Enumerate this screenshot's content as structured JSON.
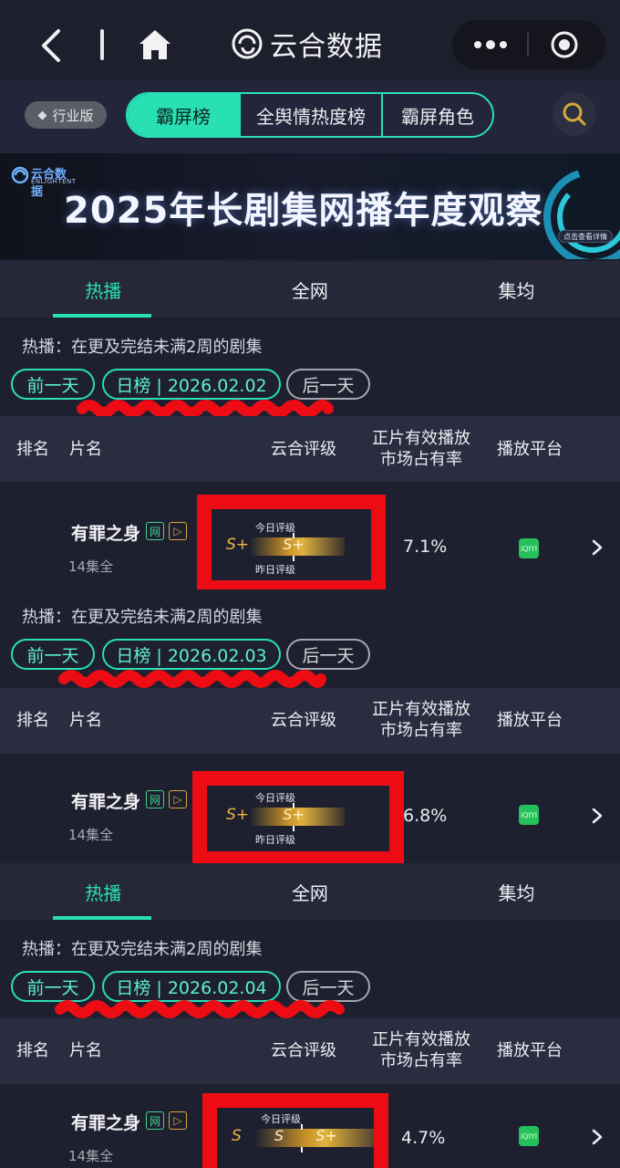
{
  "header": {
    "title": "云合数据"
  },
  "filters": {
    "edition": "行业版",
    "segments": [
      "霸屏榜",
      "全舆情热度榜",
      "霸屏角色"
    ],
    "active_segment": "霸屏榜"
  },
  "banner": {
    "logo": "云合数据",
    "logo_sub": "ENLIGHTENT",
    "title": "2025年长剧集网播年度观察",
    "cta": "点击查看详情"
  },
  "tabs": [
    "热播",
    "全网",
    "集均"
  ],
  "active_tab": "热播",
  "columns": {
    "rank": "排名",
    "title": "片名",
    "rating": "云合评级",
    "share_line1": "正片有效播放",
    "share_line2": "市场占有率",
    "platform": "播放平台"
  },
  "sections": [
    {
      "description": "热播：在更及完结未满2周的剧集",
      "prev_day": "前一天",
      "date_label": "日榜 | 2026.02.02",
      "next_day": "后一天",
      "show": {
        "name": "有罪之身",
        "tag_net": "网",
        "tag_play": "▷",
        "episodes": "14集全",
        "rating_today_label": "今日评级",
        "rating_yesterday_label": "昨日评级",
        "rating_left": "S+",
        "rating_mid": "S+",
        "share": "7.1%",
        "platform": "iQIYI"
      }
    },
    {
      "description": "热播：在更及完结未满2周的剧集",
      "prev_day": "前一天",
      "date_label": "日榜 | 2026.02.03",
      "next_day": "后一天",
      "show": {
        "name": "有罪之身",
        "tag_net": "网",
        "tag_play": "▷",
        "episodes": "14集全",
        "rating_today_label": "今日评级",
        "rating_yesterday_label": "昨日评级",
        "rating_left": "S+",
        "rating_mid": "S+",
        "share": "6.8%",
        "platform": "iQIYI"
      }
    },
    {
      "description": "热播：在更及完结未满2周的剧集",
      "prev_day": "前一天",
      "date_label": "日榜 | 2026.02.04",
      "next_day": "后一天",
      "show": {
        "name": "有罪之身",
        "tag_net": "网",
        "tag_play": "▷",
        "episodes": "14集全",
        "rating_today_label": "今日评级",
        "rating_yesterday_label": "",
        "rating_left": "S",
        "rating_mid": "S",
        "rating_right": "S+",
        "share": "4.7%",
        "platform": "iQIYI"
      }
    }
  ],
  "colors": {
    "accent": "#28e0b4",
    "annotation_red": "#ee0c14",
    "gold": "#e2b33f",
    "platform_green": "#24c05a"
  }
}
